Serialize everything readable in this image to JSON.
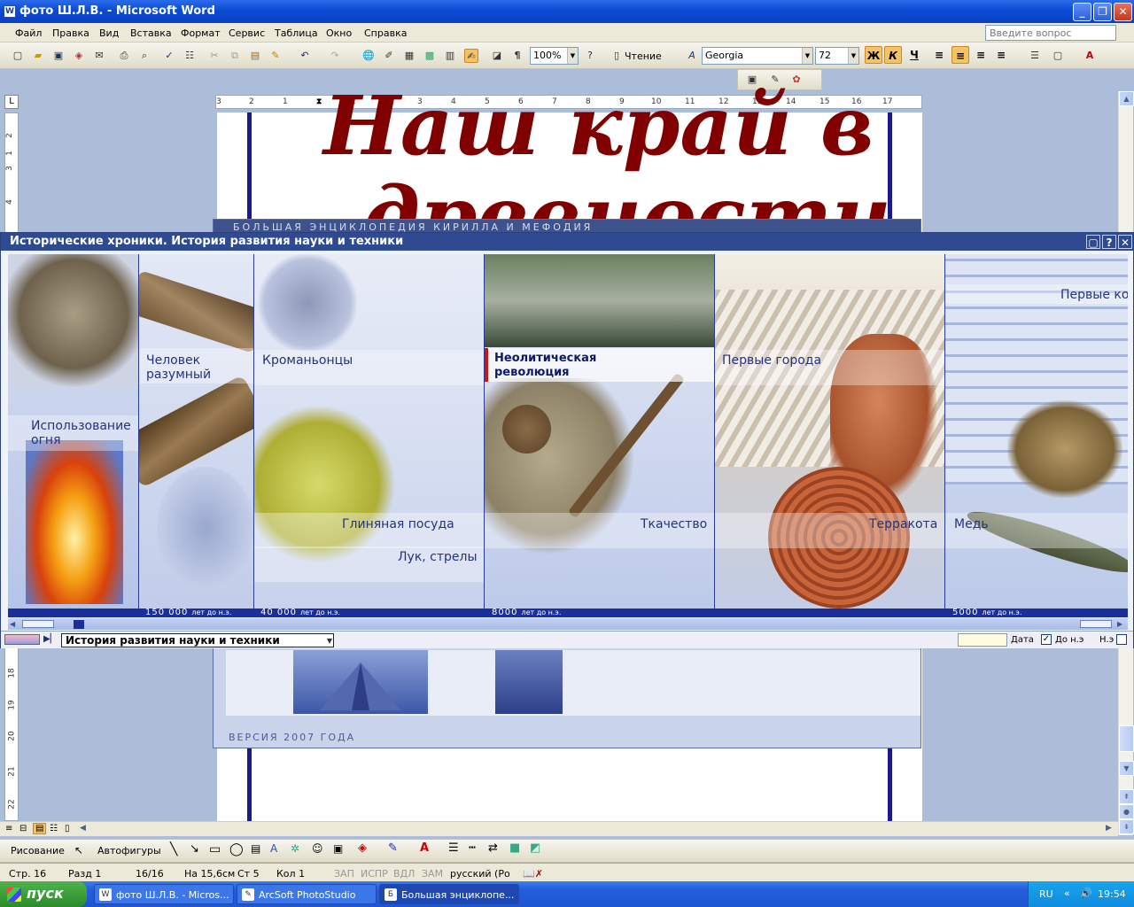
{
  "word": {
    "title": "фото Ш.Л.В. - Microsoft Word",
    "menu": [
      "Файл",
      "Правка",
      "Вид",
      "Вставка",
      "Формат",
      "Сервис",
      "Таблица",
      "Окно",
      "Справка"
    ],
    "ask_placeholder": "Введите вопрос",
    "zoom": "100%",
    "reading_label": "Чтение",
    "font_name": "Georgia",
    "font_size": "72",
    "bold_label": "Ж",
    "italic_label": "К",
    "underline_label": "Ч"
  },
  "ruler": {
    "marks": [
      "3",
      "2",
      "1",
      "1",
      "2",
      "3",
      "4",
      "5",
      "6",
      "7",
      "8",
      "9",
      "10",
      "11",
      "12",
      "13",
      "14",
      "15",
      "16",
      "17"
    ],
    "vmarks": [
      "2",
      "1",
      "3",
      "4",
      "18",
      "19",
      "20",
      "21",
      "22"
    ]
  },
  "document": {
    "title_line1": "Наш край в",
    "title_line2": "древности"
  },
  "encyclopedia_bg": {
    "title": "БОЛЬШАЯ ЭНЦИКЛОПЕДИЯ КИРИЛЛА И МЕФОДИЯ",
    "version": "ВЕРСИЯ 2007 ГОДА"
  },
  "chronicles": {
    "title": "Исторические хроники. История развития  науки и техники",
    "labels": {
      "fire": "Использование огня",
      "sapiens": "Человек разумный",
      "cromagnon": "Кроманьонцы",
      "clay": "Глиняная  посуда",
      "bow": "Лук, стрелы",
      "neolithic": "Неолитическая революция",
      "weaving": "Ткачество",
      "cities": "Первые города",
      "terracotta": "Терракота",
      "copper": "Медь",
      "first": "Первые ко"
    },
    "timeline": [
      {
        "year": "150 000",
        "suffix": "лет до н.э."
      },
      {
        "year": "40 000",
        "suffix": "лет до н.э."
      },
      {
        "year": "8000",
        "suffix": "лет до н.э."
      },
      {
        "year": "5000",
        "suffix": "лет до н.э."
      }
    ],
    "selector": "История развития науки и техники",
    "date_label": "Дата",
    "bc_label": "До н.э",
    "ad_label": "Н.э"
  },
  "drawing": {
    "draw_label": "Рисование",
    "autoshapes_label": "Автофигуры"
  },
  "status": {
    "page": "Стр. 16",
    "section": "Разд 1",
    "pages": "16/16",
    "at": "На 15,6см",
    "line": "Ст 5",
    "col": "Кол 1",
    "rec": "ЗАП",
    "trk": "ИСПР",
    "ext": "ВДЛ",
    "ovr": "ЗАМ",
    "lang": "русский (Ро"
  },
  "taskbar": {
    "start": "пуск",
    "tasks": [
      "фото Ш.Л.В. - Micros...",
      "ArcSoft PhotoStudio",
      "Большая энциклопе..."
    ],
    "lang": "RU",
    "time": "19:54"
  }
}
